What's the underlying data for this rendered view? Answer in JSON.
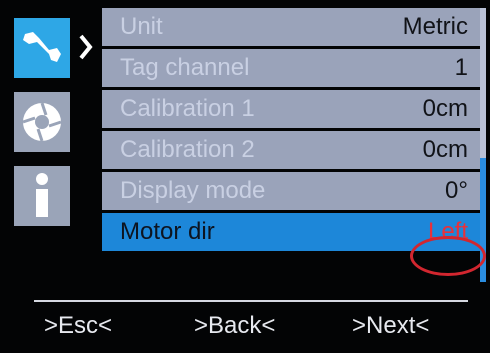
{
  "sidebar": {
    "icons": [
      {
        "name": "wrench-icon",
        "active": true
      },
      {
        "name": "camera-aperture-icon",
        "active": false
      },
      {
        "name": "info-icon",
        "active": false
      }
    ]
  },
  "menu": {
    "items": [
      {
        "label": "Unit",
        "value": "Metric"
      },
      {
        "label": "Tag channel",
        "value": "1"
      },
      {
        "label": "Calibration 1",
        "value": "0cm"
      },
      {
        "label": "Calibration 2",
        "value": "0cm"
      },
      {
        "label": "Display mode",
        "value": "0°"
      },
      {
        "label": "Motor dir",
        "value": "Left",
        "selected": true
      }
    ]
  },
  "softkeys": {
    "esc": ">Esc<",
    "back": ">Back<",
    "next": ">Next<"
  },
  "colors": {
    "accent": "#2ea7e6",
    "row": "#9aa3ba",
    "selected_row": "#1d87d9",
    "highlight_circle": "#d2262f"
  }
}
